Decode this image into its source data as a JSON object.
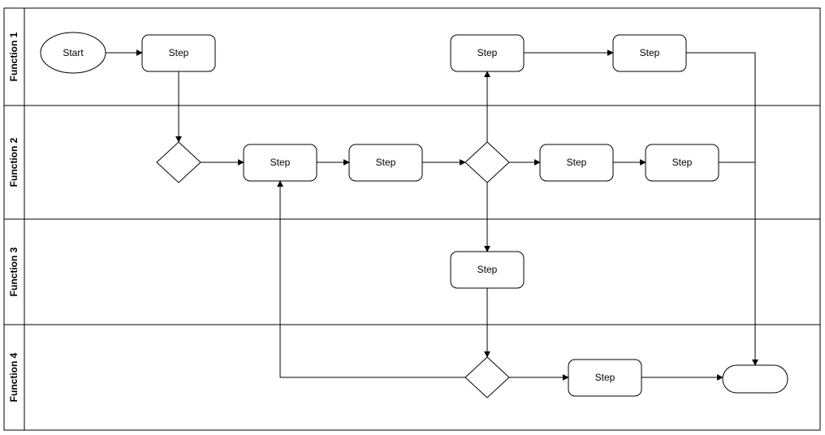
{
  "lanes": {
    "f1": "Function 1",
    "f2": "Function 2",
    "f3": "Function 3",
    "f4": "Function 4"
  },
  "nodes": {
    "start": "Start",
    "s1": "Step",
    "s2": "Step",
    "s3": "Step",
    "s4": "Step",
    "s5": "Step",
    "s6": "Step",
    "s7": "Step",
    "s8": "Step",
    "s9": "Step",
    "end": ""
  }
}
